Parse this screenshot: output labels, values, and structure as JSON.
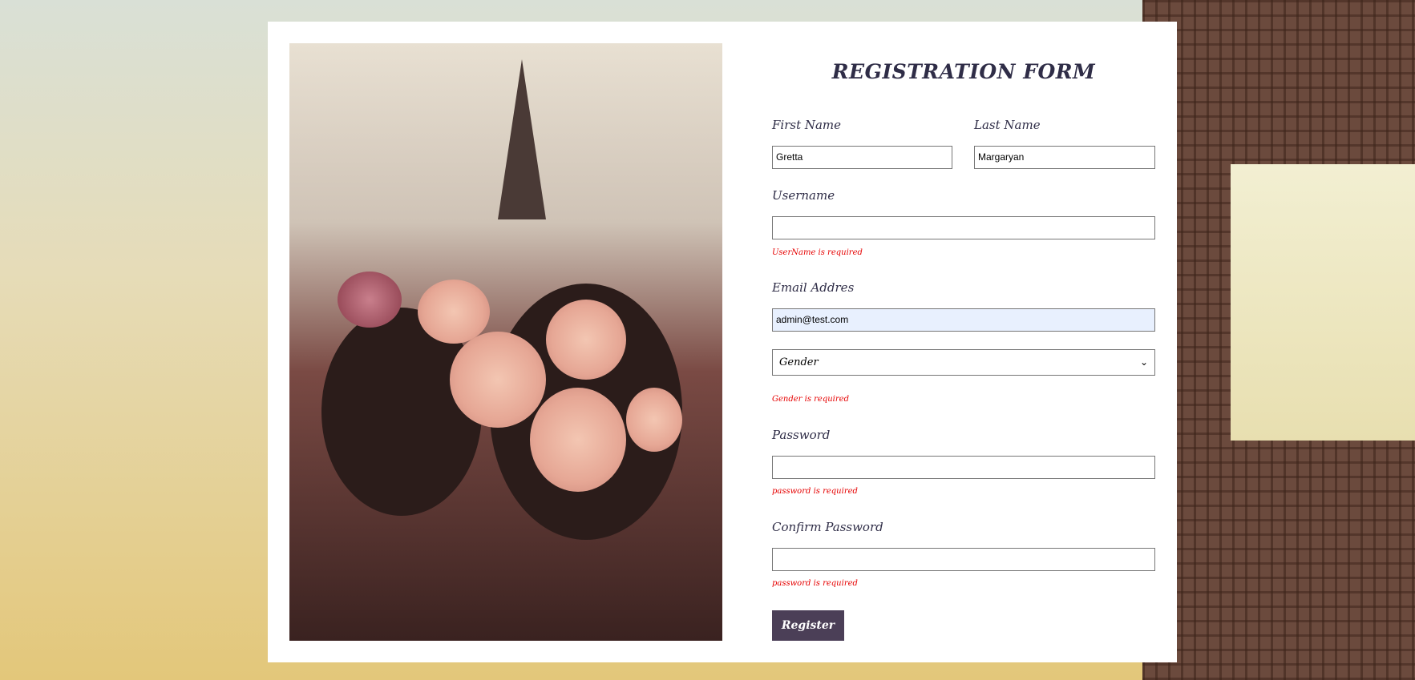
{
  "form": {
    "title": "REGISTRATION FORM",
    "first_name": {
      "label": "First Name",
      "value": "Gretta"
    },
    "last_name": {
      "label": "Last Name",
      "value": "Margaryan"
    },
    "username": {
      "label": "Username",
      "value": "",
      "error": "UserName is required"
    },
    "email": {
      "label": "Email Addres",
      "value": "admin@test.com"
    },
    "gender": {
      "selected": "Gender",
      "error": "Gender is required"
    },
    "password": {
      "label": "Password",
      "value": "",
      "error": "password is required"
    },
    "confirm_password": {
      "label": "Confirm Password",
      "value": "",
      "error": "password is required"
    },
    "register_label": "Register"
  },
  "colors": {
    "title": "#2f2d47",
    "error": "#e60000",
    "button": "#4b3f57",
    "autofill": "#e8f0fe"
  },
  "icons": {
    "gender_dropdown": "chevron-down-icon"
  }
}
